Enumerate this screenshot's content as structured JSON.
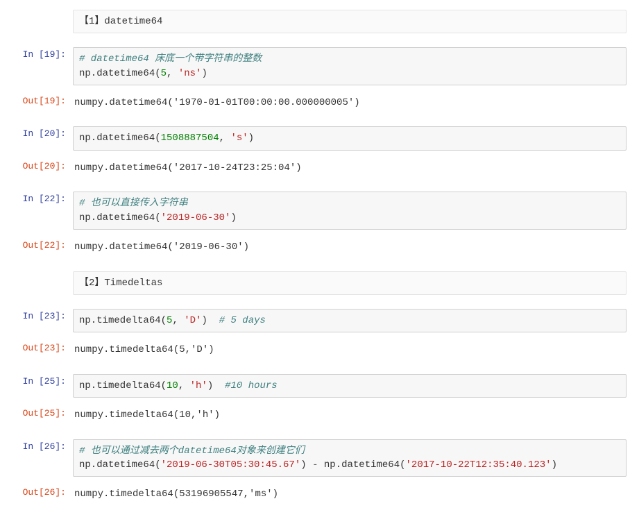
{
  "cells": [
    {
      "prompt_type": "empty",
      "prompt_text": "",
      "content_type": "markdown",
      "html": "【1】datetime64"
    },
    {
      "spacer": true
    },
    {
      "prompt_type": "in",
      "prompt_text": "In  [19]:",
      "content_type": "input",
      "html": "<span class='c-comment'># datetime64 床底一个带字符串的整数</span>\nnp.datetime64(<span class='c-num'>5</span>, <span class='c-str'>'ns'</span>)"
    },
    {
      "prompt_type": "out",
      "prompt_text": "Out[19]:",
      "content_type": "output",
      "html": "numpy.datetime64('1970-01-01T00:00:00.000000005')"
    },
    {
      "spacer": true
    },
    {
      "prompt_type": "in",
      "prompt_text": "In  [20]:",
      "content_type": "input",
      "html": "np.datetime64(<span class='c-num'>1508887504</span>, <span class='c-str'>'s'</span>)"
    },
    {
      "prompt_type": "out",
      "prompt_text": "Out[20]:",
      "content_type": "output",
      "html": "numpy.datetime64('2017-10-24T23:25:04')"
    },
    {
      "spacer": true
    },
    {
      "prompt_type": "in",
      "prompt_text": "In  [22]:",
      "content_type": "input",
      "html": "<span class='c-comment'># 也可以直接传入字符串</span>\nnp.datetime64(<span class='c-str'>'2019-06-30'</span>)"
    },
    {
      "prompt_type": "out",
      "prompt_text": "Out[22]:",
      "content_type": "output",
      "html": "numpy.datetime64('2019-06-30')"
    },
    {
      "spacer": true
    },
    {
      "prompt_type": "empty",
      "prompt_text": "",
      "content_type": "markdown",
      "html": "【2】Timedeltas"
    },
    {
      "spacer": true
    },
    {
      "prompt_type": "in",
      "prompt_text": "In  [23]:",
      "content_type": "input",
      "html": "np.timedelta64(<span class='c-num'>5</span>, <span class='c-str'>'D'</span>)  <span class='c-comment'># 5 days</span>"
    },
    {
      "prompt_type": "out",
      "prompt_text": "Out[23]:",
      "content_type": "output",
      "html": "numpy.timedelta64(5,'D')"
    },
    {
      "spacer": true
    },
    {
      "prompt_type": "in",
      "prompt_text": "In  [25]:",
      "content_type": "input",
      "html": "np.timedelta64(<span class='c-num'>10</span>, <span class='c-str'>'h'</span>)  <span class='c-comment'>#10 hours</span>"
    },
    {
      "prompt_type": "out",
      "prompt_text": "Out[25]:",
      "content_type": "output",
      "html": "numpy.timedelta64(10,'h')"
    },
    {
      "spacer": true
    },
    {
      "prompt_type": "in",
      "prompt_text": "In  [26]:",
      "content_type": "input",
      "html": "<span class='c-comment'># 也可以通过减去两个datetime64对象来创建它们</span>\nnp.datetime64(<span class='c-str'>'2019-06-30T05:30:45.67'</span>) <span class='c-op'>-</span> np.datetime64(<span class='c-str'>'2017-10-22T12:35:40.123'</span>)"
    },
    {
      "prompt_type": "out",
      "prompt_text": "Out[26]:",
      "content_type": "output",
      "html": "numpy.timedelta64(53196905547,'ms')"
    }
  ]
}
